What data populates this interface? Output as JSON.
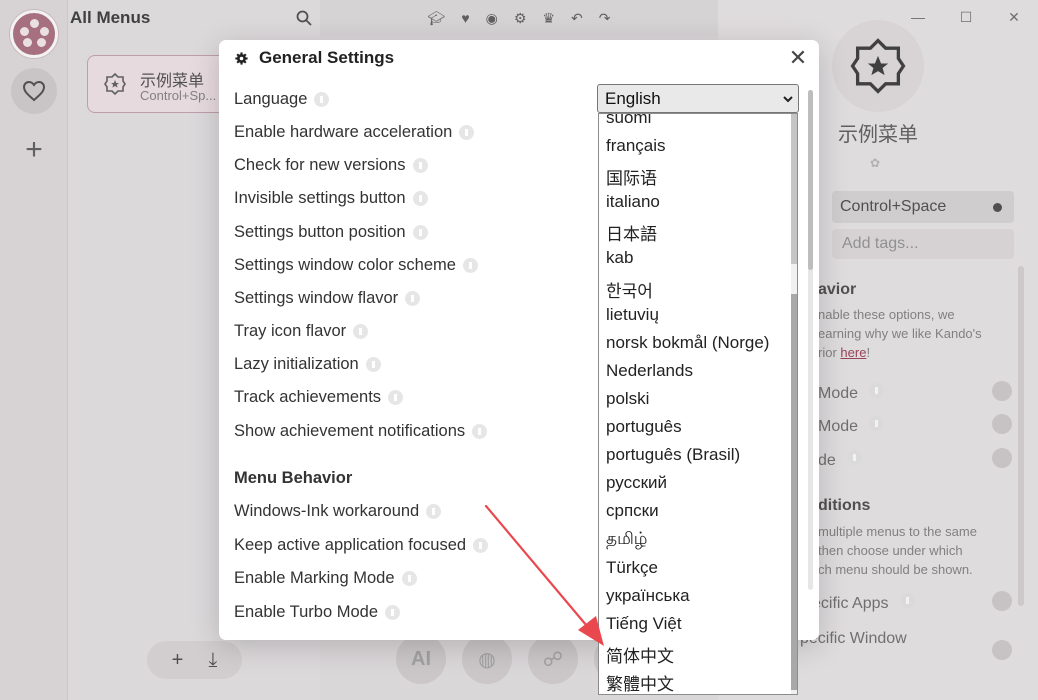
{
  "sidebar": {
    "title": "All Menus"
  },
  "menu_card": {
    "name": "示例菜单",
    "shortcut": "Control+Sp..."
  },
  "properties": {
    "name": "示例菜单",
    "shortcut": "Control+Space",
    "tags_placeholder": "Add tags...",
    "behavior_heading": "avior",
    "behavior_text_1": "nable these options, we",
    "behavior_text_2": "earning why we like Kando's",
    "behavior_text_3": "rior",
    "behavior_link": "here",
    "behavior_text_end": "!",
    "opt1": "Mode",
    "opt2": "Mode",
    "opt3": "de",
    "conditions_heading": "ditions",
    "conditions_text_1": "multiple menus to the same",
    "conditions_text_2": "then choose under which",
    "conditions_text_3": "ch menu should be shown.",
    "cond_opt1": "ecific Apps",
    "cond_opt2": "pecific Window"
  },
  "bottom_icons": [
    "AI",
    "",
    "",
    ""
  ],
  "dialog": {
    "title": "General Settings",
    "language_label": "Language",
    "language_value": "English",
    "settings": [
      "Enable hardware acceleration",
      "Check for new versions",
      "Invisible settings button",
      "Settings button position",
      "Settings window color scheme",
      "Settings window flavor",
      "Tray icon flavor",
      "Lazy initialization",
      "Track achievements",
      "Show achievement notifications"
    ],
    "section_menu_behavior": "Menu Behavior",
    "behavior_settings": [
      "Windows-Ink workaround",
      "Keep active application focused",
      "Enable Marking Mode",
      "Enable Turbo Mode"
    ]
  },
  "language_options": [
    "suomi",
    "français",
    "国际语",
    "italiano",
    "日本語",
    "kab",
    "한국어",
    "lietuvių",
    "norsk bokmål (Norge)",
    "Nederlands",
    "polski",
    "português",
    "português (Brasil)",
    "русский",
    "српски",
    "தமிழ்",
    "Türkçe",
    "українська",
    "Tiếng Việt",
    "简体中文",
    "繁體中文"
  ],
  "colors": {
    "accent": "#b07788",
    "arrow": "#e8484e"
  }
}
